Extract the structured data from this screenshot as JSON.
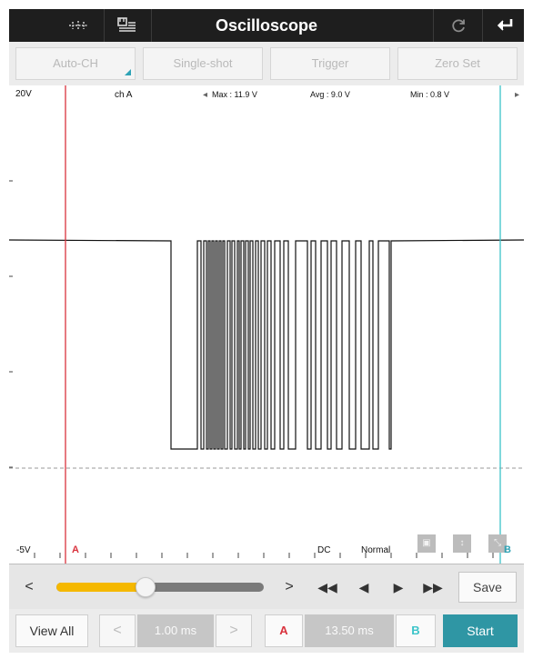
{
  "header": {
    "title": "Oscilloscope",
    "left_icons": [
      "cursor-toggle-icon",
      "channel-list-icon"
    ],
    "right_icons": [
      "refresh-icon",
      "back-icon"
    ]
  },
  "toolbar": {
    "buttons": [
      {
        "label": "Auto-CH"
      },
      {
        "label": "Single-shot"
      },
      {
        "label": "Trigger"
      },
      {
        "label": "Zero Set"
      }
    ]
  },
  "scope": {
    "y_max_label": "20V",
    "y_min_label": "-5V",
    "channel_label": "ch A",
    "max_label": "Max : 11.9 V",
    "avg_label": "Avg : 9.0 V",
    "min_label": "Min : 0.8 V",
    "coupling": "DC",
    "trigger_mode": "Normal",
    "cursor_a_label": "A",
    "cursor_b_label": "B",
    "colors": {
      "cursor_a": "#d9323d",
      "cursor_b": "#3cc4c9",
      "trace": "#111111"
    }
  },
  "controls": {
    "slider_position": 0.43,
    "save_label": "Save",
    "nav_icons": [
      "prev-icon",
      "next-icon",
      "fast-rewind-icon",
      "step-back-icon",
      "play-icon",
      "fast-forward-icon"
    ]
  },
  "bottom": {
    "view_all_label": "View All",
    "time_div": "1.00 ms",
    "cursor_a_label": "A",
    "cursor_delta": "13.50 ms",
    "cursor_b_label": "B",
    "start_label": "Start",
    "colors": {
      "accent": "#2f96a4",
      "cursor_a": "#d9323d",
      "cursor_b": "#3cc4c9"
    }
  }
}
